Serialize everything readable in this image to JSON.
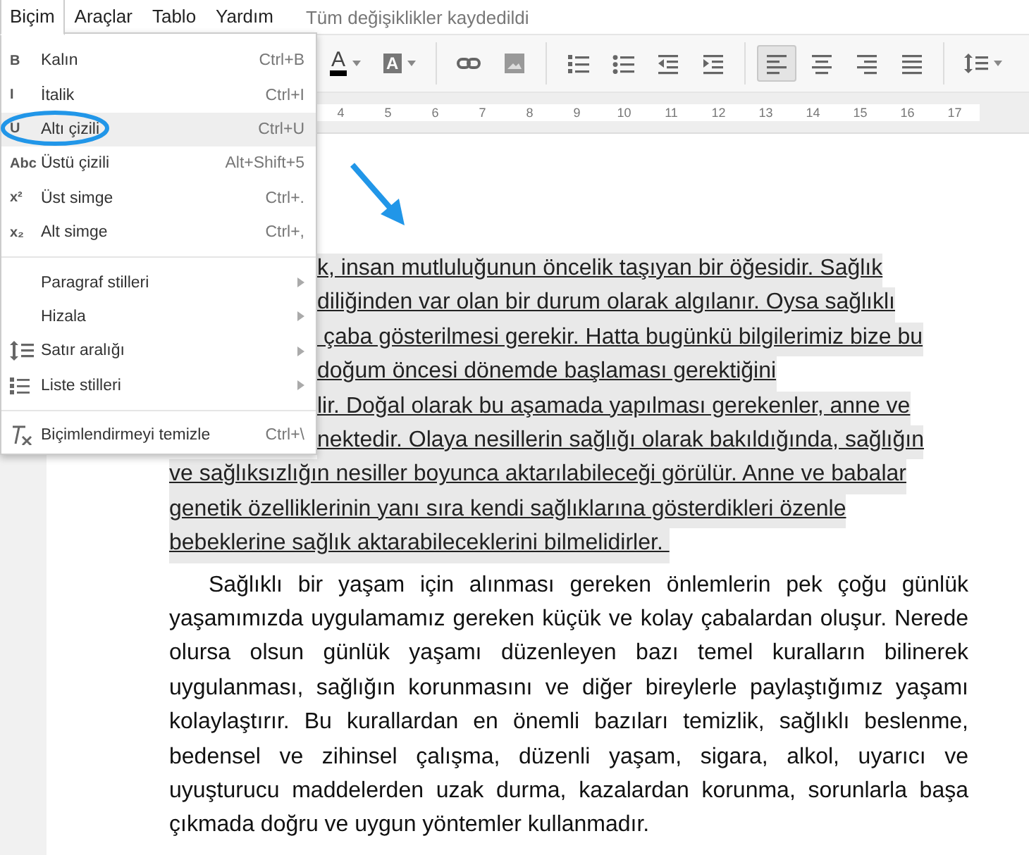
{
  "menubar": [
    {
      "label": "Biçim",
      "selected": true
    },
    {
      "label": "Araçlar",
      "selected": false
    },
    {
      "label": "Tablo",
      "selected": false
    },
    {
      "label": "Yardım",
      "selected": false
    }
  ],
  "save_status": "Tüm değişiklikler kaydedildi",
  "toolbar": [
    {
      "kind": "textcolor",
      "label": "A"
    },
    {
      "kind": "highlight",
      "label": "A"
    },
    {
      "kind": "sep"
    },
    {
      "kind": "link"
    },
    {
      "kind": "image"
    },
    {
      "kind": "sep"
    },
    {
      "kind": "numbered"
    },
    {
      "kind": "bulleted"
    },
    {
      "kind": "outdent"
    },
    {
      "kind": "indent"
    },
    {
      "kind": "sep"
    },
    {
      "kind": "left",
      "selected": true
    },
    {
      "kind": "center",
      "selected": false
    },
    {
      "kind": "right",
      "selected": false
    },
    {
      "kind": "justify",
      "selected": false
    },
    {
      "kind": "sep"
    },
    {
      "kind": "spacing"
    }
  ],
  "ruler": [
    "4",
    "5",
    "6",
    "7",
    "8",
    "9",
    "10",
    "11",
    "12",
    "13",
    "14",
    "15",
    "16",
    "17"
  ],
  "format_menu": [
    {
      "kind": "glyph",
      "glyph": "B",
      "label": "Kalın",
      "shortcut": "Ctrl+B",
      "selected": false
    },
    {
      "kind": "glyph",
      "glyph": "I",
      "label": "İtalik",
      "shortcut": "Ctrl+I",
      "selected": false
    },
    {
      "kind": "glyph",
      "glyph": "U",
      "label": "Altı çizili",
      "shortcut": "Ctrl+U",
      "selected": true
    },
    {
      "kind": "glyph",
      "glyph": "Abc",
      "label": "Üstü çizili",
      "shortcut": "Alt+Shift+5",
      "selected": false
    },
    {
      "kind": "glyph",
      "glyph": "x²",
      "label": "Üst simge",
      "shortcut": "Ctrl+.",
      "selected": false
    },
    {
      "kind": "glyph",
      "glyph": "x₂",
      "label": "Alt simge",
      "shortcut": "Ctrl+,",
      "selected": false
    },
    {
      "kind": "separator"
    },
    {
      "kind": "submenu",
      "label": "Paragraf stilleri",
      "selected": false
    },
    {
      "kind": "submenu",
      "label": "Hizala",
      "selected": false
    },
    {
      "kind": "spacing",
      "label": "Satır aralığı",
      "selected": false
    },
    {
      "kind": "list",
      "label": "Liste stilleri",
      "selected": false
    },
    {
      "kind": "separator"
    },
    {
      "kind": "clear",
      "label": "Biçimlendirmeyi temizle",
      "shortcut": "Ctrl+\\",
      "selected": false
    }
  ],
  "document": {
    "underlined_lines": [
      {
        "text": "k, insan mutluluğunun öncelik taşıyan bir öğesidir. Sağlık",
        "covered": true
      },
      {
        "text": "diliğinden var olan bir durum olarak algılanır. Oysa sağlıklı",
        "covered": true
      },
      {
        "text": " çaba gösterilmesi gerekir. Hatta bugünkü bilgilerimiz bize bu",
        "covered": true
      },
      {
        "text": "doğum öncesi dönemde başlaması gerektiğini",
        "covered": true
      },
      {
        "text": "lir. Doğal olarak bu aşamada yapılması gerekenler, anne ve",
        "covered": true
      },
      {
        "text": "nektedir. Olaya nesillerin sağlığı olarak bakıldığında, sağlığın",
        "covered": true
      },
      {
        "text": "ve sağlıksızlığın nesiller boyunca aktarılabileceği görülür. Anne ve babalar",
        "covered": false
      },
      {
        "text": "genetik özelliklerinin yanı sıra kendi sağlıklarına gösterdikleri özenle",
        "covered": false
      },
      {
        "text": "bebeklerine sağlık aktarabileceklerini bilmelidirler. ",
        "covered": false
      }
    ],
    "paragraph": "Sağlıklı bir yaşam için alınması gereken önlemlerin pek çoğu günlük yaşamımızda  uygulamamız gereken küçük ve kolay çabalardan oluşur. Nerede olursa olsun günlük yaşamı düzenleyen bazı temel kuralların bilinerek uygulanması, sağlığın korunmasını ve diğer bireylerle paylaştığımız yaşamı kolaylaştırır. Bu kurallardan en önemli bazıları temizlik, sağlıklı beslenme, bedensel ve zihinsel çalışma, düzenli yaşam, sigara, alkol, uyarıcı ve uyuşturucu maddelerden uzak durma, kazalardan korunma, sorunlarla başa çıkmada doğru ve uygun yöntemler kullanmadır."
  }
}
